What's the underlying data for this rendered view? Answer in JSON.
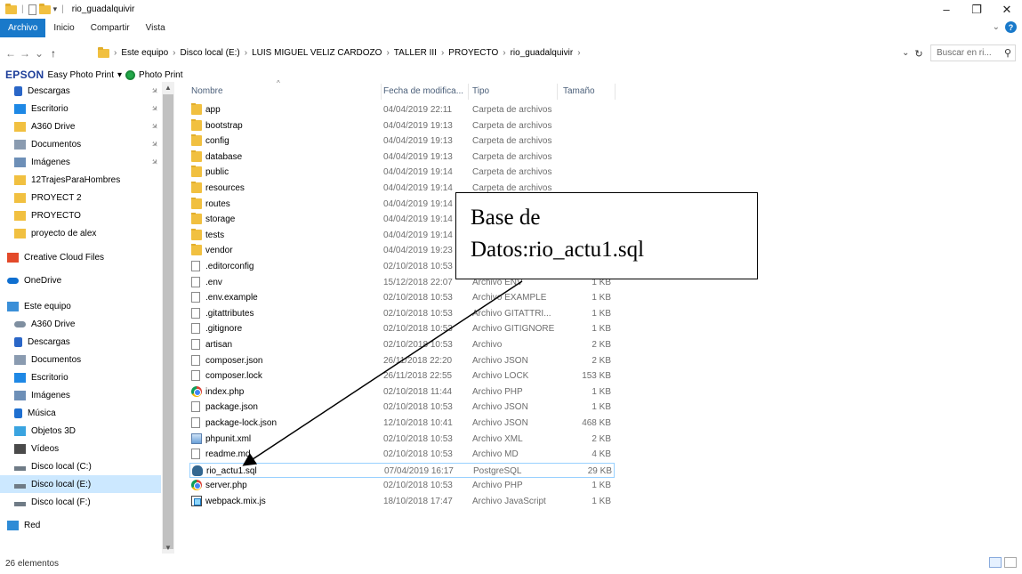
{
  "window": {
    "title": "rio_guadalquivir",
    "buttons": [
      "–",
      "❐",
      "✕"
    ]
  },
  "ribbon": {
    "tabs": [
      "Archivo",
      "Inicio",
      "Compartir",
      "Vista"
    ],
    "expand_icon": "chevron-down-icon"
  },
  "nav": {
    "back": "←",
    "forward": "→",
    "recent": "⌄",
    "up": "↑"
  },
  "address": {
    "crumbs": [
      "Este equipo",
      "Disco local (E:)",
      "LUIS MIGUEL VELIZ CARDOZO",
      "TALLER III",
      "PROYECTO",
      "rio_guadalquivir"
    ],
    "separator": "›"
  },
  "search": {
    "placeholder": "Buscar en ri...",
    "icon": "search-icon"
  },
  "toolbar": {
    "epson": "EPSON",
    "epson_app": "Easy Photo Print",
    "dropdown": "▾",
    "photo_print": "Photo Print"
  },
  "sidebar": {
    "items": [
      {
        "label": "Descargas",
        "icon": "download-icon",
        "pinned": true
      },
      {
        "label": "Escritorio",
        "icon": "desktop-icon",
        "pinned": true
      },
      {
        "label": "A360 Drive",
        "icon": "folder-icon",
        "pinned": true
      },
      {
        "label": "Documentos",
        "icon": "documents-icon",
        "pinned": true
      },
      {
        "label": "Imágenes",
        "icon": "pictures-icon",
        "pinned": true
      },
      {
        "label": "12TrajesParaHombres",
        "icon": "folder-icon"
      },
      {
        "label": "PROYECT 2",
        "icon": "folder-icon"
      },
      {
        "label": "PROYECTO",
        "icon": "folder-icon"
      },
      {
        "label": "proyecto de alex",
        "icon": "folder-icon"
      },
      {
        "label": "Creative Cloud Files",
        "icon": "creative-cloud-icon"
      },
      {
        "label": "OneDrive",
        "icon": "onedrive-icon"
      },
      {
        "label": "Este equipo",
        "icon": "computer-icon"
      },
      {
        "label": "A360 Drive",
        "icon": "cloud-drive-icon"
      },
      {
        "label": "Descargas",
        "icon": "download-icon"
      },
      {
        "label": "Documentos",
        "icon": "documents-icon"
      },
      {
        "label": "Escritorio",
        "icon": "desktop-icon"
      },
      {
        "label": "Imágenes",
        "icon": "pictures-icon"
      },
      {
        "label": "Música",
        "icon": "music-icon"
      },
      {
        "label": "Objetos 3D",
        "icon": "objects-3d-icon"
      },
      {
        "label": "Vídeos",
        "icon": "videos-icon"
      },
      {
        "label": "Disco local (C:)",
        "icon": "drive-icon"
      },
      {
        "label": "Disco local (E:)",
        "icon": "drive-icon",
        "selected": true
      },
      {
        "label": "Disco local (F:)",
        "icon": "drive-icon"
      },
      {
        "label": "Red",
        "icon": "network-icon"
      }
    ]
  },
  "columns": {
    "name": "Nombre",
    "date": "Fecha de modifica...",
    "type": "Tipo",
    "size": "Tamaño"
  },
  "files": [
    {
      "name": "app",
      "date": "04/04/2019 22:11",
      "type": "Carpeta de archivos",
      "size": "",
      "icon": "folder"
    },
    {
      "name": "bootstrap",
      "date": "04/04/2019 19:13",
      "type": "Carpeta de archivos",
      "size": "",
      "icon": "folder"
    },
    {
      "name": "config",
      "date": "04/04/2019 19:13",
      "type": "Carpeta de archivos",
      "size": "",
      "icon": "folder"
    },
    {
      "name": "database",
      "date": "04/04/2019 19:13",
      "type": "Carpeta de archivos",
      "size": "",
      "icon": "folder"
    },
    {
      "name": "public",
      "date": "04/04/2019 19:14",
      "type": "Carpeta de archivos",
      "size": "",
      "icon": "folder"
    },
    {
      "name": "resources",
      "date": "04/04/2019 19:14",
      "type": "Carpeta de archivos",
      "size": "",
      "icon": "folder"
    },
    {
      "name": "routes",
      "date": "04/04/2019 19:14",
      "type": "",
      "size": "",
      "icon": "folder"
    },
    {
      "name": "storage",
      "date": "04/04/2019 19:14",
      "type": "",
      "size": "",
      "icon": "folder"
    },
    {
      "name": "tests",
      "date": "04/04/2019 19:14",
      "type": "",
      "size": "",
      "icon": "folder"
    },
    {
      "name": "vendor",
      "date": "04/04/2019 19:23",
      "type": "",
      "size": "",
      "icon": "folder"
    },
    {
      "name": ".editorconfig",
      "date": "02/10/2018 10:53",
      "type": "",
      "size": "",
      "icon": "file"
    },
    {
      "name": ".env",
      "date": "15/12/2018 22:07",
      "type": "Archivo ENV",
      "size": "1 KB",
      "icon": "file"
    },
    {
      "name": ".env.example",
      "date": "02/10/2018 10:53",
      "type": "Archivo EXAMPLE",
      "size": "1 KB",
      "icon": "file"
    },
    {
      "name": ".gitattributes",
      "date": "02/10/2018 10:53",
      "type": "Archivo GITATTRI...",
      "size": "1 KB",
      "icon": "file"
    },
    {
      "name": ".gitignore",
      "date": "02/10/2018 10:53",
      "type": "Archivo GITIGNORE",
      "size": "1 KB",
      "icon": "file"
    },
    {
      "name": "artisan",
      "date": "02/10/2018 10:53",
      "type": "Archivo",
      "size": "2 KB",
      "icon": "file"
    },
    {
      "name": "composer.json",
      "date": "26/11/2018 22:20",
      "type": "Archivo JSON",
      "size": "2 KB",
      "icon": "file"
    },
    {
      "name": "composer.lock",
      "date": "26/11/2018 22:55",
      "type": "Archivo LOCK",
      "size": "153 KB",
      "icon": "file"
    },
    {
      "name": "index.php",
      "date": "02/10/2018 11:44",
      "type": "Archivo PHP",
      "size": "1 KB",
      "icon": "chrome"
    },
    {
      "name": "package.json",
      "date": "02/10/2018 10:53",
      "type": "Archivo JSON",
      "size": "1 KB",
      "icon": "file"
    },
    {
      "name": "package-lock.json",
      "date": "12/10/2018 10:41",
      "type": "Archivo JSON",
      "size": "468 KB",
      "icon": "file"
    },
    {
      "name": "phpunit.xml",
      "date": "02/10/2018 10:53",
      "type": "Archivo XML",
      "size": "2 KB",
      "icon": "xml"
    },
    {
      "name": "readme.md",
      "date": "02/10/2018 10:53",
      "type": "Archivo MD",
      "size": "4 KB",
      "icon": "file"
    },
    {
      "name": "rio_actu1.sql",
      "date": "07/04/2019 16:17",
      "type": "PostgreSQL",
      "size": "29 KB",
      "icon": "pg",
      "selected": true
    },
    {
      "name": "server.php",
      "date": "02/10/2018 10:53",
      "type": "Archivo PHP",
      "size": "1 KB",
      "icon": "chrome"
    },
    {
      "name": "webpack.mix.js",
      "date": "18/10/2018 17:47",
      "type": "Archivo JavaScript",
      "size": "1 KB",
      "icon": "webpack"
    }
  ],
  "status": {
    "count": "26 elementos"
  },
  "annotation": {
    "line1": "Base de",
    "line2": "Datos:rio_actu1.sql"
  }
}
